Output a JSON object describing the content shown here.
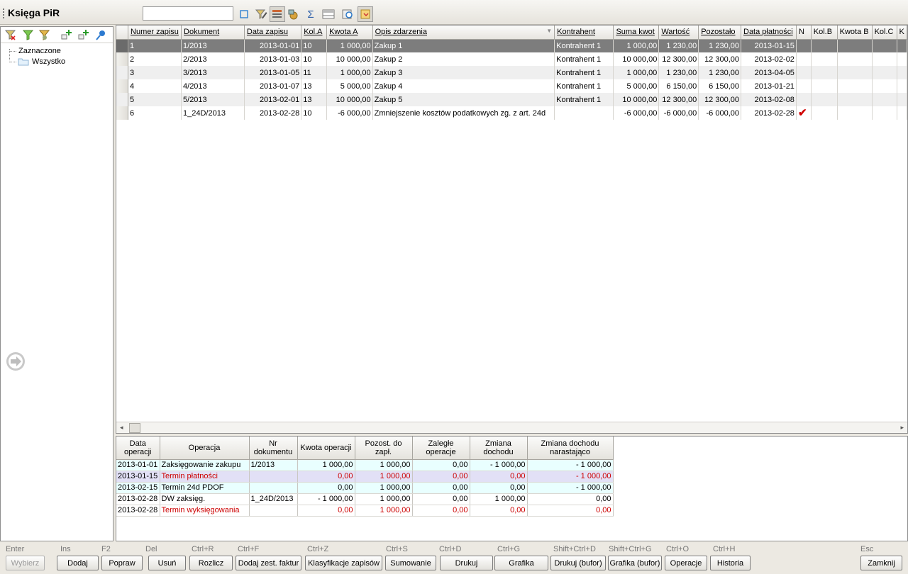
{
  "window": {
    "title": "Księga PiR",
    "search_value": ""
  },
  "toolbar_icons": [
    "square-icon",
    "filter-pencil-icon",
    "filter-list-icon",
    "lock-icon",
    "sigma-icon",
    "columns-icon",
    "view-icon",
    "folder-action-icon"
  ],
  "left_panel": {
    "tool_icons": [
      "filter-clear-icon",
      "filter-green-icon",
      "filter-funnel-icon",
      "add-node-icon",
      "add-subnode-icon",
      "pin-icon"
    ],
    "tree": {
      "root": "Zaznaczone",
      "child": "Wszystko"
    }
  },
  "main_table": {
    "columns": [
      "Numer zapisu",
      "Dokument",
      "Data zapisu",
      "Kol.A",
      "Kwota A",
      "Opis zdarzenia",
      "Kontrahent",
      "Suma kwot",
      "Wartość",
      "Pozostało",
      "Data płatności",
      "N",
      "Kol.B",
      "Kwota B",
      "Kol.C",
      "K"
    ],
    "rows": [
      [
        "1",
        "1/2013",
        "2013-01-01",
        "10",
        "1 000,00",
        "Zakup 1",
        "Kontrahent 1",
        "1 000,00",
        "1 230,00",
        "1 230,00",
        "2013-01-15",
        "",
        "",
        "",
        "",
        ""
      ],
      [
        "2",
        "2/2013",
        "2013-01-03",
        "10",
        "10 000,00",
        "Zakup 2",
        "Kontrahent 1",
        "10 000,00",
        "12 300,00",
        "12 300,00",
        "2013-02-02",
        "",
        "",
        "",
        "",
        ""
      ],
      [
        "3",
        "3/2013",
        "2013-01-05",
        "11",
        "1 000,00",
        "Zakup 3",
        "Kontrahent 1",
        "1 000,00",
        "1 230,00",
        "1 230,00",
        "2013-04-05",
        "",
        "",
        "",
        "",
        ""
      ],
      [
        "4",
        "4/2013",
        "2013-01-07",
        "13",
        "5 000,00",
        "Zakup 4",
        "Kontrahent 1",
        "5 000,00",
        "6 150,00",
        "6 150,00",
        "2013-01-21",
        "",
        "",
        "",
        "",
        ""
      ],
      [
        "5",
        "5/2013",
        "2013-02-01",
        "13",
        "10 000,00",
        "Zakup 5",
        "Kontrahent 1",
        "10 000,00",
        "12 300,00",
        "12 300,00",
        "2013-02-08",
        "",
        "",
        "",
        "",
        ""
      ],
      [
        "6",
        "1_24D/2013",
        "2013-02-28",
        "10",
        "-6 000,00",
        "Zmniejszenie kosztów podatkowych zg. z art. 24d",
        "",
        "-6 000,00",
        "-6 000,00",
        "-6 000,00",
        "2013-02-28",
        "✔",
        "",
        "",
        "",
        ""
      ]
    ]
  },
  "ops_table": {
    "columns": [
      "Data operacji",
      "Operacja",
      "Nr dokumentu",
      "Kwota operacji",
      "Pozost. do zapł.",
      "Zaległe operacje",
      "Zmiana dochodu",
      "Zmiana dochodu narastająco"
    ],
    "rows": [
      {
        "cells": [
          "2013-01-01",
          "Zaksięgowanie zakupu",
          "1/2013",
          "1 000,00",
          "1 000,00",
          "0,00",
          "- 1 000,00",
          "- 1 000,00"
        ],
        "bg": "#e9ffff",
        "red": false
      },
      {
        "cells": [
          "2013-01-15",
          "Termin płatności",
          "",
          "0,00",
          "1 000,00",
          "0,00",
          "0,00",
          "- 1 000,00"
        ],
        "bg": "#e2e0f6",
        "red": true
      },
      {
        "cells": [
          "2013-02-15",
          "Termin 24d PDOF",
          "",
          "0,00",
          "1 000,00",
          "0,00",
          "0,00",
          "- 1 000,00"
        ],
        "bg": "#e9ffff",
        "red": false
      },
      {
        "cells": [
          "2013-02-28",
          "DW zaksięg.",
          "1_24D/2013",
          "- 1 000,00",
          "1 000,00",
          "0,00",
          "1 000,00",
          "0,00"
        ],
        "bg": "#ffffff",
        "red": false
      },
      {
        "cells": [
          "2013-02-28",
          "Termin wyksięgowania",
          "",
          "0,00",
          "1 000,00",
          "0,00",
          "0,00",
          "0,00"
        ],
        "bg": "#ffffff",
        "red": true
      }
    ]
  },
  "buttons": [
    {
      "key": "Enter",
      "label": "Wybierz",
      "disabled": true
    },
    {
      "key": "Ins",
      "label": "Dodaj"
    },
    {
      "key": "F2",
      "label": "Popraw"
    },
    {
      "key": "Del",
      "label": "Usuń"
    },
    {
      "key": "Ctrl+R",
      "label": "Rozlicz"
    },
    {
      "key": "Ctrl+F",
      "label": "Dodaj zest. faktur"
    },
    {
      "key": "Ctrl+Z",
      "label": "Klasyfikacje zapisów"
    },
    {
      "key": "Ctrl+S",
      "label": "Sumowanie"
    },
    {
      "key": "Ctrl+D",
      "label": "Drukuj"
    },
    {
      "key": "Ctrl+G",
      "label": "Grafika"
    },
    {
      "key": "Shift+Ctrl+D",
      "label": "Drukuj (bufor)"
    },
    {
      "key": "Shift+Ctrl+G",
      "label": "Grafika (bufor)"
    },
    {
      "key": "Ctrl+O",
      "label": "Operacje"
    },
    {
      "key": "Ctrl+H",
      "label": "Historia"
    },
    {
      "key": "Esc",
      "label": "Zamknij"
    }
  ]
}
